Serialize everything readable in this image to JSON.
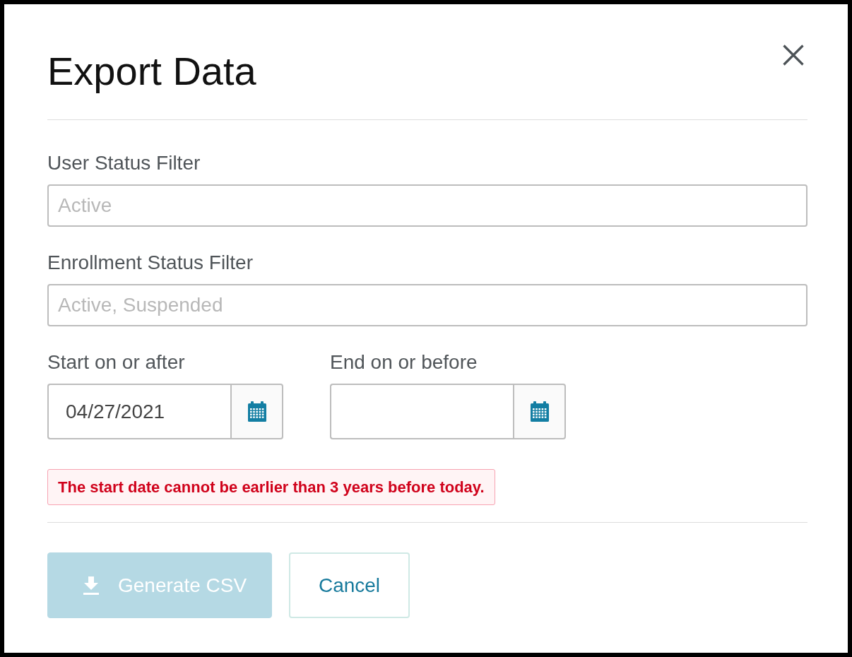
{
  "dialog": {
    "title": "Export Data"
  },
  "fields": [
    {
      "label": "User Status Filter",
      "placeholder": "Active"
    },
    {
      "label": "Enrollment Status Filter",
      "placeholder": "Active, Suspended"
    }
  ],
  "date_fields": [
    {
      "label": "Start on or after",
      "value": "04/27/2021"
    },
    {
      "label": "End on or before"
    }
  ],
  "error": "The start date cannot be earlier than 3 years before today.",
  "buttons": [
    {
      "kind": "primary",
      "label": "Generate CSV",
      "disabled": true
    },
    {
      "kind": "secondary",
      "label": "Cancel",
      "disabled": false
    }
  ]
}
